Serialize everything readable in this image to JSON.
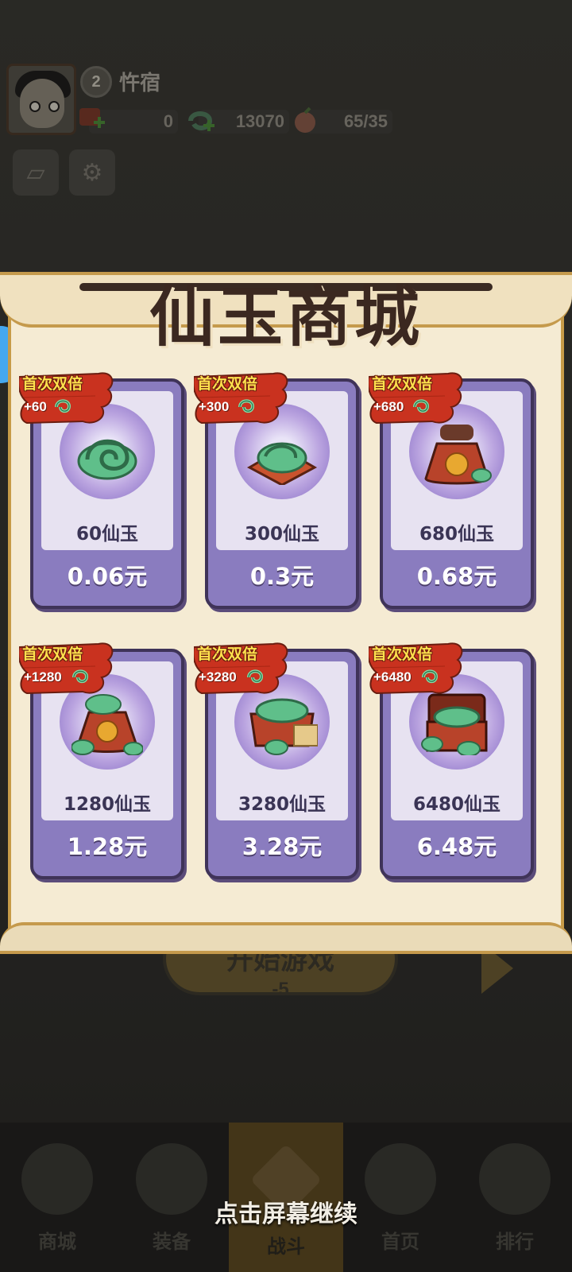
{
  "player": {
    "level": "2",
    "name": "忤宿"
  },
  "resources": [
    {
      "icon": "red-ticket-icon",
      "value": "0"
    },
    {
      "icon": "jade-icon",
      "value": "13070"
    },
    {
      "icon": "peach-icon",
      "value": "65/35"
    }
  ],
  "shop": {
    "title": "仙玉商城",
    "items": [
      {
        "badge": "首次双倍",
        "bonus": "+60",
        "amount": "60仙玉",
        "price": "0.06元",
        "art": "jade-coil-icon"
      },
      {
        "badge": "首次双倍",
        "bonus": "+300",
        "amount": "300仙玉",
        "price": "0.3元",
        "art": "jade-plate-icon"
      },
      {
        "badge": "首次双倍",
        "bonus": "+680",
        "amount": "680仙玉",
        "price": "0.68元",
        "art": "fortune-bag-icon"
      },
      {
        "badge": "首次双倍",
        "bonus": "+1280",
        "amount": "1280仙玉",
        "price": "1.28元",
        "art": "fortune-bag-large-icon"
      },
      {
        "badge": "首次双倍",
        "bonus": "+3280",
        "amount": "3280仙玉",
        "price": "3.28元",
        "art": "jade-box-icon"
      },
      {
        "badge": "首次双倍",
        "bonus": "+6480",
        "amount": "6480仙玉",
        "price": "6.48元",
        "art": "jade-chest-icon"
      }
    ]
  },
  "start_button": {
    "label": "开始游戏",
    "cost": "-5"
  },
  "nav": [
    {
      "label": "商城",
      "icon": "shop-icon",
      "active": false
    },
    {
      "label": "装备",
      "icon": "armor-icon",
      "active": false
    },
    {
      "label": "战斗",
      "icon": "swords-icon",
      "active": true
    },
    {
      "label": "首页",
      "icon": "mountain-icon",
      "active": false
    },
    {
      "label": "排行",
      "icon": "ranking-icon",
      "active": false
    }
  ],
  "overlay_hint": "点击屏幕继续",
  "colors": {
    "card": "#8a7cbf",
    "jade": "#5fbf8a",
    "ribbon": "#c9321f",
    "title": "#3b2820"
  }
}
